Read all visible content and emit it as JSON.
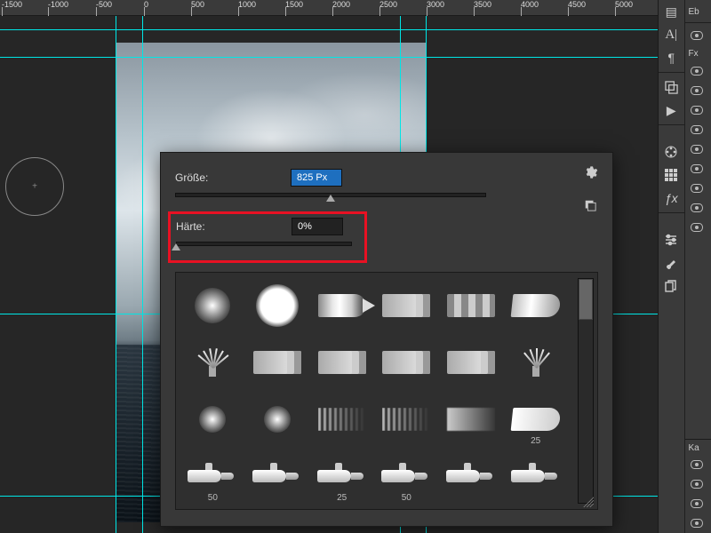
{
  "ruler": {
    "ticks": [
      "-1500",
      "-1000",
      "-500",
      "0",
      "500",
      "1000",
      "1500",
      "2000",
      "2500",
      "3000",
      "3500",
      "4000",
      "4500",
      "5000"
    ]
  },
  "panel": {
    "size_label": "Größe:",
    "size_value": "825 Px",
    "hardness_label": "Härte:",
    "hardness_value": "0%",
    "brushes": [
      {
        "label": ""
      },
      {
        "label": ""
      },
      {
        "label": ""
      },
      {
        "label": ""
      },
      {
        "label": ""
      },
      {
        "label": ""
      },
      {
        "label": ""
      },
      {
        "label": ""
      },
      {
        "label": ""
      },
      {
        "label": ""
      },
      {
        "label": ""
      },
      {
        "label": ""
      },
      {
        "label": ""
      },
      {
        "label": ""
      },
      {
        "label": ""
      },
      {
        "label": ""
      },
      {
        "label": ""
      },
      {
        "label": "25"
      },
      {
        "label": "50"
      },
      {
        "label": ""
      },
      {
        "label": "25"
      },
      {
        "label": "50"
      },
      {
        "label": ""
      },
      {
        "label": ""
      }
    ]
  },
  "right": {
    "tab_layers": "Eb",
    "tab_fx": "Fx"
  }
}
